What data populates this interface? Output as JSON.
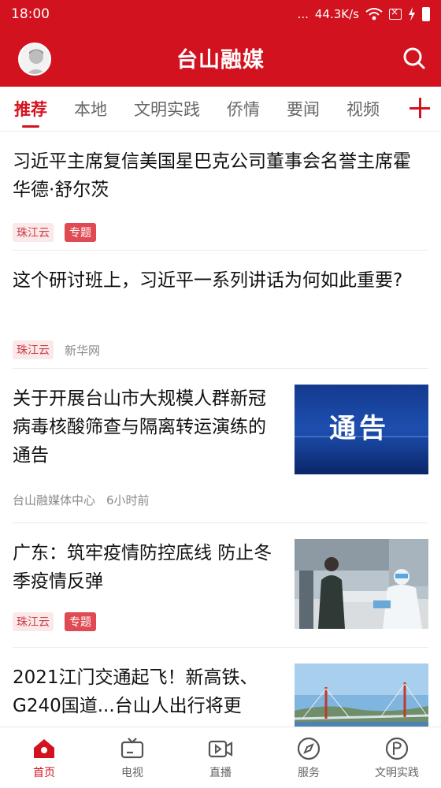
{
  "status_bar": {
    "time": "18:00",
    "dots": "...",
    "speed": "44.3K/s"
  },
  "header": {
    "title": "台山融媒"
  },
  "tabs": [
    {
      "label": "推荐",
      "active": true
    },
    {
      "label": "本地"
    },
    {
      "label": "文明实践"
    },
    {
      "label": "侨情"
    },
    {
      "label": "要闻"
    },
    {
      "label": "视频"
    }
  ],
  "articles": [
    {
      "title": "习近平主席复信美国星巴克公司董事会名誉主席霍华德·舒尔茨",
      "source": "珠江云",
      "tag": "专题"
    },
    {
      "title": "这个研讨班上，习近平一系列讲话为何如此重要?",
      "source": "珠江云",
      "extra": "新华网"
    },
    {
      "title": "关于开展台山市大规模人群新冠病毒核酸筛查与隔离转运演练的通告",
      "source": "台山融媒体中心",
      "time": "6小时前",
      "thumb_text": "通告"
    },
    {
      "title": "广东：筑牢疫情防控底线 防止冬季疫情反弹",
      "source": "珠江云",
      "tag": "专题"
    },
    {
      "title": "2021江门交通起飞！新高铁、G240国道...台山人出行将更"
    }
  ],
  "bottom_nav": [
    {
      "label": "首页",
      "icon": "home-icon",
      "active": true
    },
    {
      "label": "电视",
      "icon": "tv-icon"
    },
    {
      "label": "直播",
      "icon": "live-video-icon"
    },
    {
      "label": "服务",
      "icon": "compass-icon"
    },
    {
      "label": "文明实践",
      "icon": "flag-circle-icon"
    }
  ],
  "colors": {
    "brand_red": "#d3121f",
    "tag_red": "#e04a52",
    "source_bg": "#fbe8e9"
  }
}
